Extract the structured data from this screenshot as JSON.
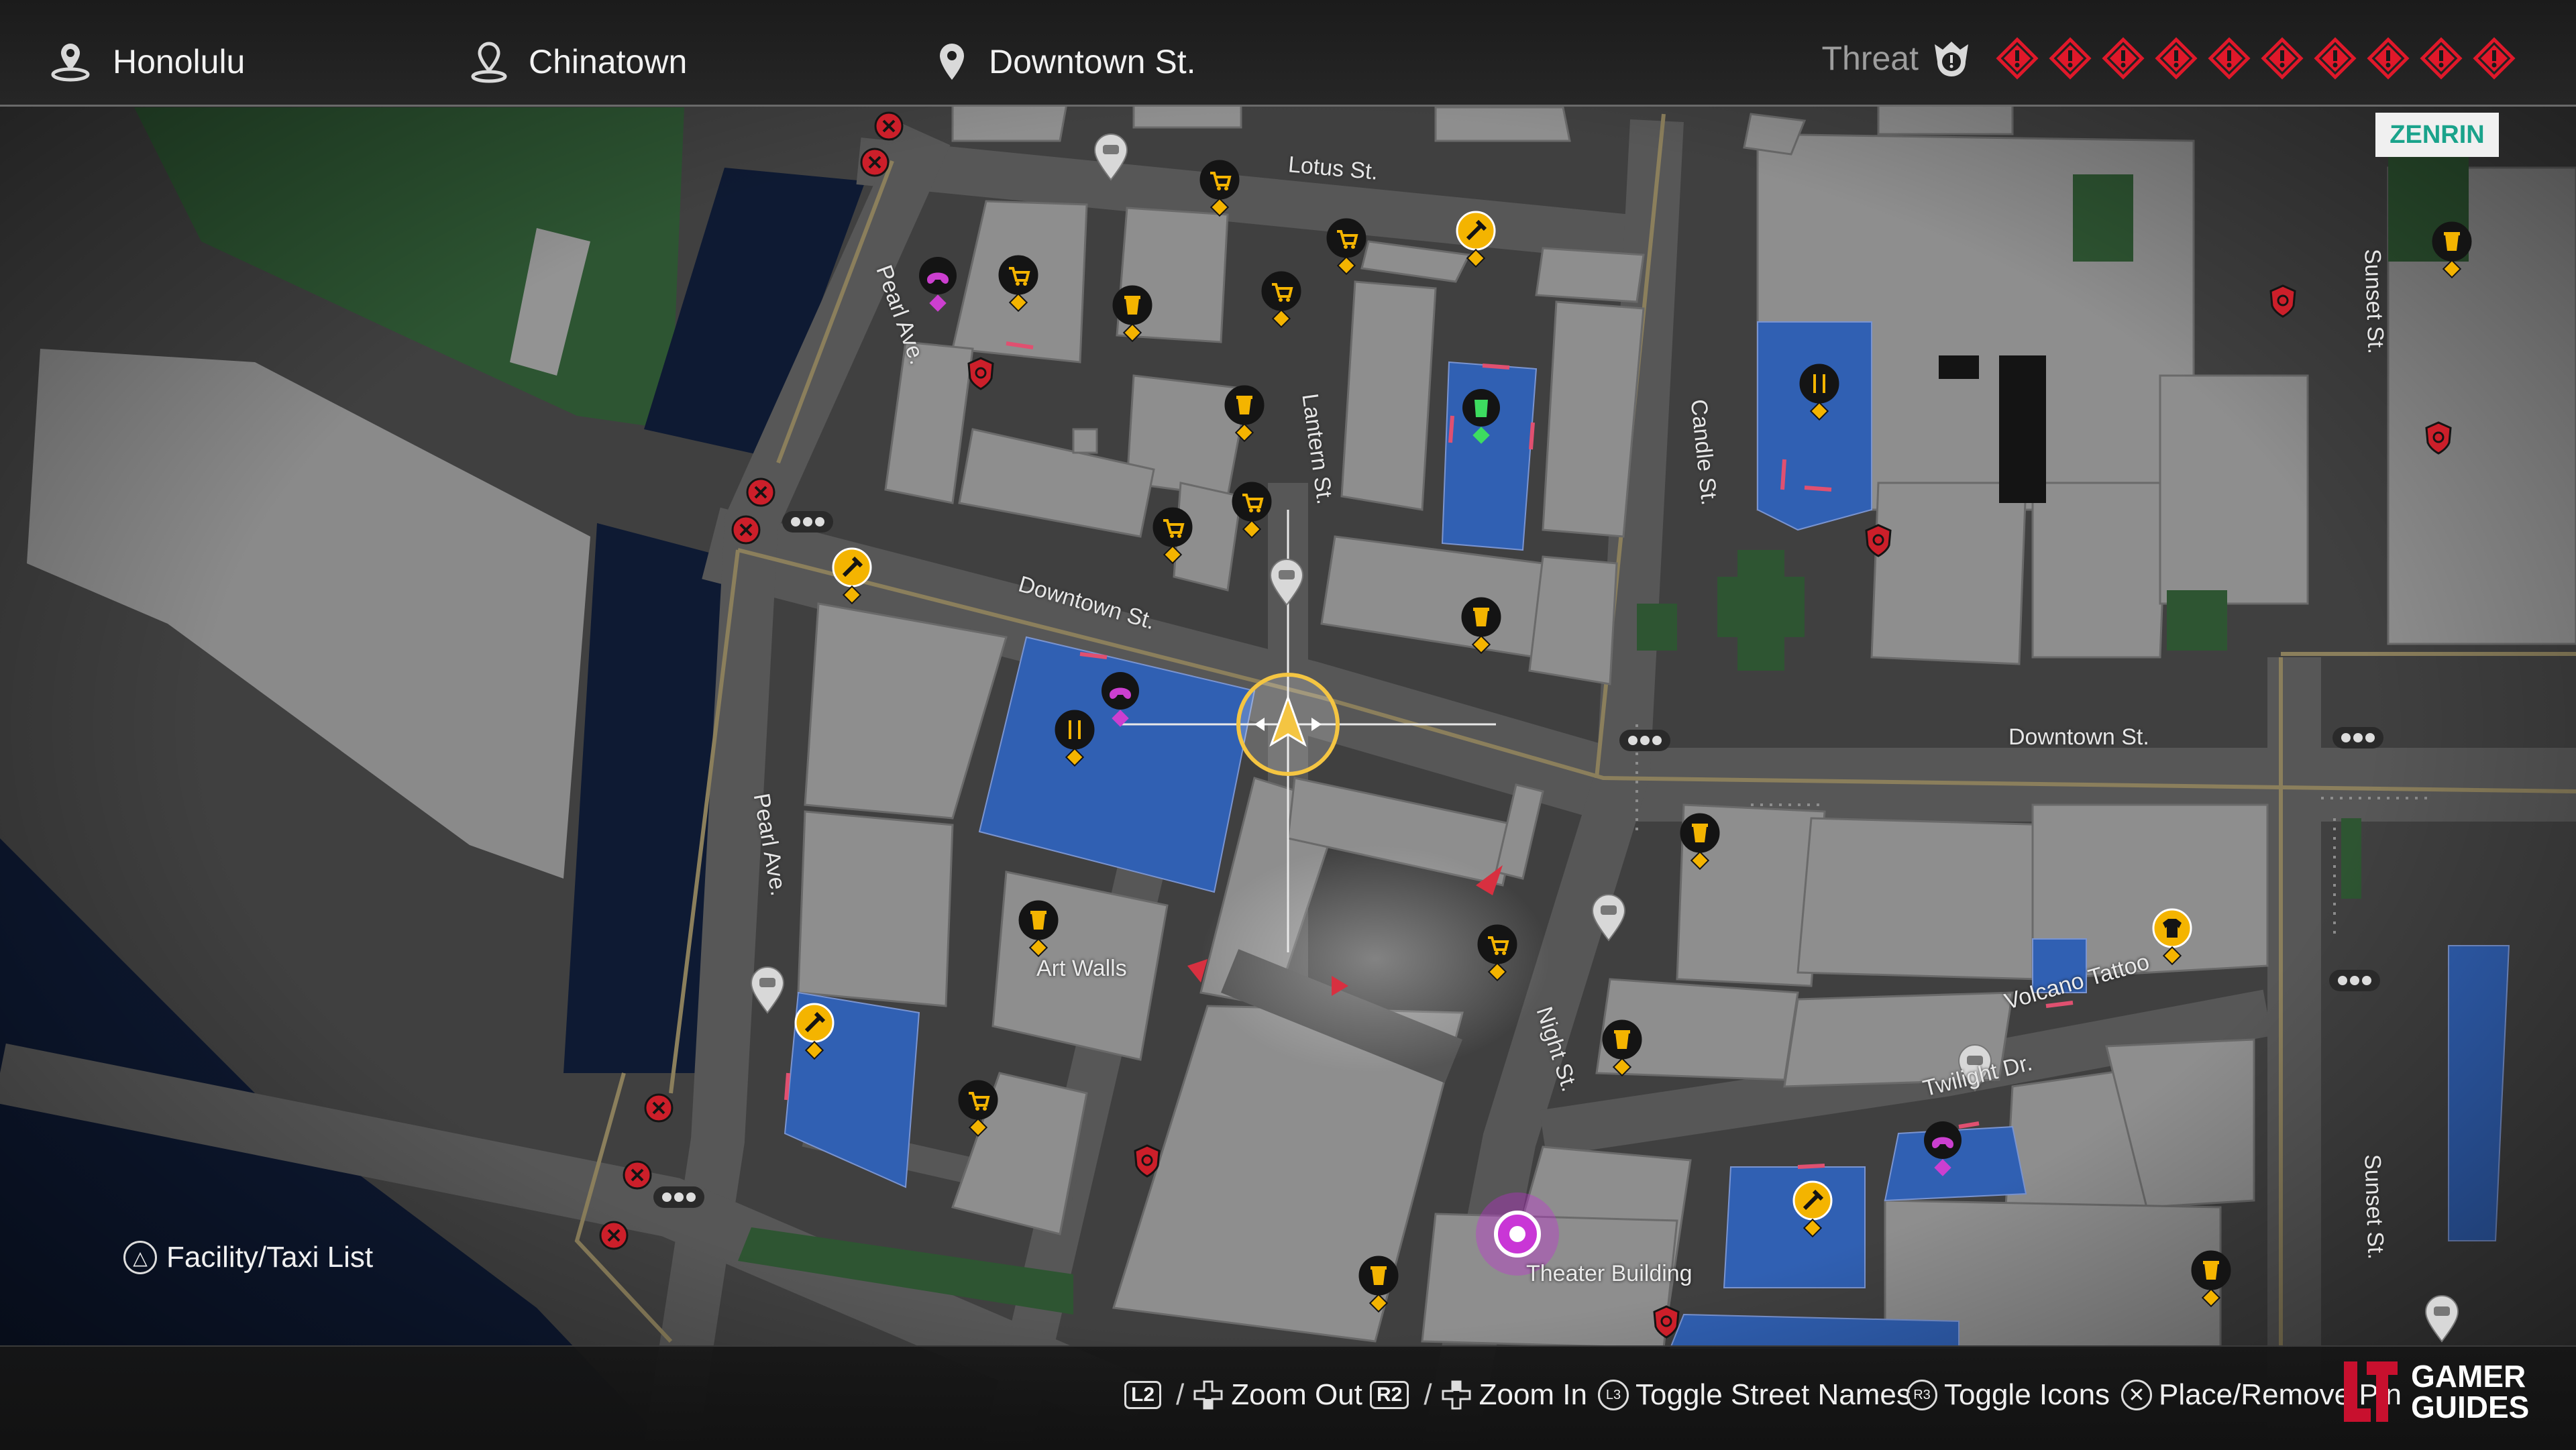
{
  "header": {
    "region": "Honolulu",
    "district": "Chinatown",
    "street": "Downtown St.",
    "threat_label": "Threat",
    "threat_pips": 10
  },
  "map": {
    "provider_badge": "ZENRIN",
    "streets": {
      "lotus": "Lotus St.",
      "pearl_north": "Pearl Ave.",
      "pearl_south": "Pearl Ave.",
      "lantern": "Lantern St.",
      "downtown_west": "Downtown St.",
      "downtown_east": "Downtown St.",
      "candle": "Candle St.",
      "sunset_north": "Sunset St.",
      "sunset_south": "Sunset St.",
      "night": "Night St.",
      "twilight": "Twilight Dr."
    },
    "places": {
      "art_walls": "Art Walls",
      "volcano_tattoo": "Volcano Tattoo",
      "theater_building": "Theater Building"
    },
    "colors": {
      "road": "#555555",
      "block": "#8e8e8e",
      "water": "#0e1a33",
      "park": "#2e5633",
      "building_blue": "#2f5fb0",
      "shop_icon": "#f4b400",
      "hostile_icon": "#cc1f2a",
      "arcade_icon": "#cc3fd0",
      "threat_color": "#e0182a"
    }
  },
  "footer": {
    "facility_list": "Facility/Taxi List",
    "facility_button": "△",
    "controls": [
      {
        "key": "L2",
        "label": "Zoom Out"
      },
      {
        "key": "R2",
        "label": "Zoom In"
      },
      {
        "key": "L3",
        "label": "Toggle Street Names"
      },
      {
        "key": "R3",
        "label": "Toggle Icons"
      },
      {
        "key": "✕",
        "label": "Place/Remove Pin"
      }
    ],
    "logo_line1": "GAMER",
    "logo_line2": "GUIDES"
  }
}
